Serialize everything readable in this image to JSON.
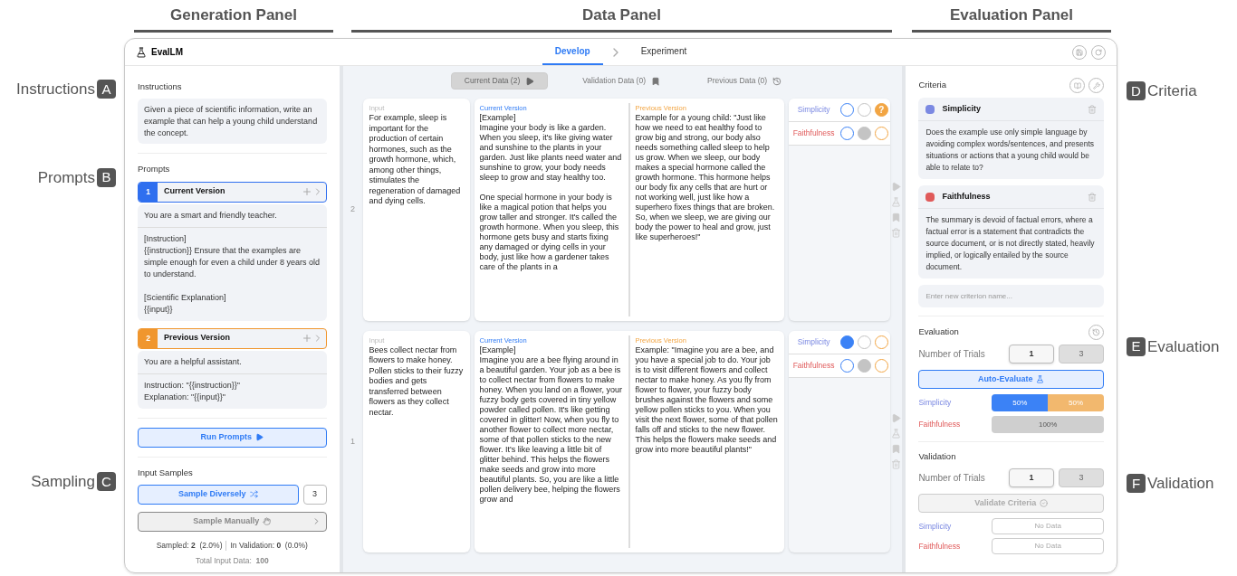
{
  "panel_headings": [
    {
      "label": "Generation Panel"
    },
    {
      "label": "Data Panel"
    },
    {
      "label": "Evaluation Panel"
    }
  ],
  "annotations_left": [
    {
      "text": "Instructions",
      "letter": "A"
    },
    {
      "text": "Prompts",
      "letter": "B"
    },
    {
      "text": "Sampling",
      "letter": "C"
    }
  ],
  "annotations_right": [
    {
      "letter": "D",
      "text": "Criteria"
    },
    {
      "letter": "E",
      "text": "Evaluation"
    },
    {
      "letter": "F",
      "text": "Validation"
    }
  ],
  "app": {
    "name": "EvalLM",
    "tabs": [
      {
        "label": "Develop",
        "selected": true
      },
      {
        "label": "Experiment",
        "selected": false
      }
    ]
  },
  "generation": {
    "instructions": {
      "title": "Instructions",
      "value": "Given a piece of scientific information, write an example that can help a young child understand the concept."
    },
    "prompts": {
      "title": "Prompts",
      "items": [
        {
          "number": "1",
          "name": "Current Version",
          "kind": "current",
          "system": "You are a smart and friendly teacher.",
          "template": "[Instruction]\n{{instruction}} Ensure that the examples are simple enough for even a child under 8 years old to understand.\n\n[Scientific Explanation]\n{{input}}"
        },
        {
          "number": "2",
          "name": "Previous Version",
          "kind": "previous",
          "system": "You are a helpful assistant.",
          "template": "Instruction: \"{{instruction}}\"\nExplanation: \"{{input}}\""
        }
      ]
    },
    "run_button": "Run Prompts",
    "sampling": {
      "title": "Input Samples",
      "diverse_button": "Sample Diversely",
      "count": "3",
      "manual_button": "Sample Manually",
      "sampled": "Sampled: **2**  (2.0%)",
      "in_validation": "In Validation: **0**  (0.0%)",
      "total": "Total Input Data:  **100**"
    }
  },
  "data": {
    "tabs": [
      {
        "label": "Current Data (2)",
        "kind": "current",
        "selected": true
      },
      {
        "label": "Validation Data (0)",
        "kind": "validation",
        "selected": false
      },
      {
        "label": "Previous Data (0)",
        "kind": "previous",
        "selected": false
      }
    ],
    "rows": [
      {
        "index": "2",
        "input_label": "Input",
        "input": "For example, sleep is important for the production of certain hormones, such as the growth hormone, which, among other things, stimulates the regeneration of damaged and dying cells.",
        "outputs": [
          {
            "kind": "current",
            "label": "Current Version",
            "text": "[Example]\nImagine your body is like a garden. When you sleep, it's like giving water and sunshine to the plants in your garden. Just like plants need water and sunshine to grow, your body needs sleep to grow and stay healthy too.\n\nOne special hormone in your body is like a magical potion that helps you grow taller and stronger. It's called the growth hormone. When you sleep, this hormone gets busy and starts fixing any damaged or dying cells in your body, just like how a gardener takes care of the plants in a"
          },
          {
            "kind": "previous",
            "label": "Previous Version",
            "text": "Example for a young child: \"Just like how we need to eat healthy food to grow big and strong, our body also needs something called sleep to help us grow. When we sleep, our body makes a special hormone called the growth hormone. This hormone helps our body fix any cells that are hurt or not working well, just like how a superhero fixes things that are broken. So, when we sleep, we are giving our body the power to heal and grow, just like superheroes!\""
          }
        ],
        "scores": [
          {
            "criterion": "Simplicity",
            "marks": [
              {
                "kind": "current",
                "selected": false
              },
              {
                "kind": "tie",
                "selected": false
              },
              {
                "kind": "previous",
                "selected": true,
                "label": "?"
              }
            ]
          },
          {
            "criterion": "Faithfulness",
            "marks": [
              {
                "kind": "current",
                "selected": false
              },
              {
                "kind": "tie",
                "selected": true
              },
              {
                "kind": "previous",
                "selected": false
              }
            ]
          }
        ]
      },
      {
        "index": "1",
        "input_label": "Input",
        "input": "Bees collect nectar from flowers to make honey. Pollen sticks to their fuzzy bodies and gets transferred between flowers as they collect nectar.",
        "outputs": [
          {
            "kind": "current",
            "label": "Current Version",
            "text": "[Example]\nImagine you are a bee flying around in a beautiful garden. Your job as a bee is to collect nectar from flowers to make honey. When you land on a flower, your fuzzy body gets covered in tiny yellow powder called pollen. It's like getting covered in glitter! Now, when you fly to another flower to collect more nectar, some of that pollen sticks to the new flower. It's like leaving a little bit of glitter behind. This helps the flowers make seeds and grow into more beautiful plants. So, you are like a little pollen delivery bee, helping the flowers grow and"
          },
          {
            "kind": "previous",
            "label": "Previous Version",
            "text": "Example: \"Imagine you are a bee, and you have a special job to do. Your job is to visit different flowers and collect nectar to make honey. As you fly from flower to flower, your fuzzy body brushes against the flowers and some yellow pollen sticks to you. When you visit the next flower, some of that pollen falls off and sticks to the new flower. This helps the flowers make seeds and grow into more beautiful plants!\""
          }
        ],
        "scores": [
          {
            "criterion": "Simplicity",
            "marks": [
              {
                "kind": "current",
                "selected": true
              },
              {
                "kind": "tie",
                "selected": false
              },
              {
                "kind": "previous",
                "selected": false
              }
            ]
          },
          {
            "criterion": "Faithfulness",
            "marks": [
              {
                "kind": "current",
                "selected": false
              },
              {
                "kind": "tie",
                "selected": true
              },
              {
                "kind": "previous",
                "selected": false
              }
            ]
          }
        ]
      }
    ]
  },
  "criteria": {
    "title": "Criteria",
    "items": [
      {
        "name": "Simplicity",
        "color": "#7b89e2",
        "description": "Does the example use only simple language by avoiding complex words/sentences, and presents situations or actions that a young child would be able to relate to?"
      },
      {
        "name": "Faithfulness",
        "color": "#e05a5a",
        "description": "The summary is devoid of factual errors, where a factual error is a statement that contradicts the source document, or is not directly stated, heavily implied, or logically entailed by the source document."
      }
    ],
    "new_placeholder": "Enter new criterion name..."
  },
  "evaluation": {
    "title": "Evaluation",
    "trials_label": "Number of Trials",
    "trials": [
      {
        "label": "1",
        "selected": true
      },
      {
        "label": "3",
        "selected": false
      }
    ],
    "button": "Auto-Evaluate",
    "disabled": false,
    "results": [
      {
        "criterion": "Simplicity",
        "segments": [
          {
            "kind": "current",
            "level": 0.5,
            "label": "50%"
          },
          {
            "kind": "previous",
            "level": 0.5,
            "label": "50%"
          }
        ]
      },
      {
        "criterion": "Faithfulness",
        "segments": [
          {
            "kind": "tie",
            "level": 1,
            "label": "100%"
          }
        ]
      }
    ]
  },
  "validation": {
    "title": "Validation",
    "trials_label": "Number of Trials",
    "trials": [
      {
        "label": "1",
        "selected": true
      },
      {
        "label": "3",
        "selected": false
      }
    ],
    "button": "Validate Criteria",
    "disabled": true,
    "results": [
      {
        "criterion": "Simplicity",
        "value": "No Data"
      },
      {
        "criterion": "Faithfulness",
        "value": "No Data"
      }
    ]
  }
}
